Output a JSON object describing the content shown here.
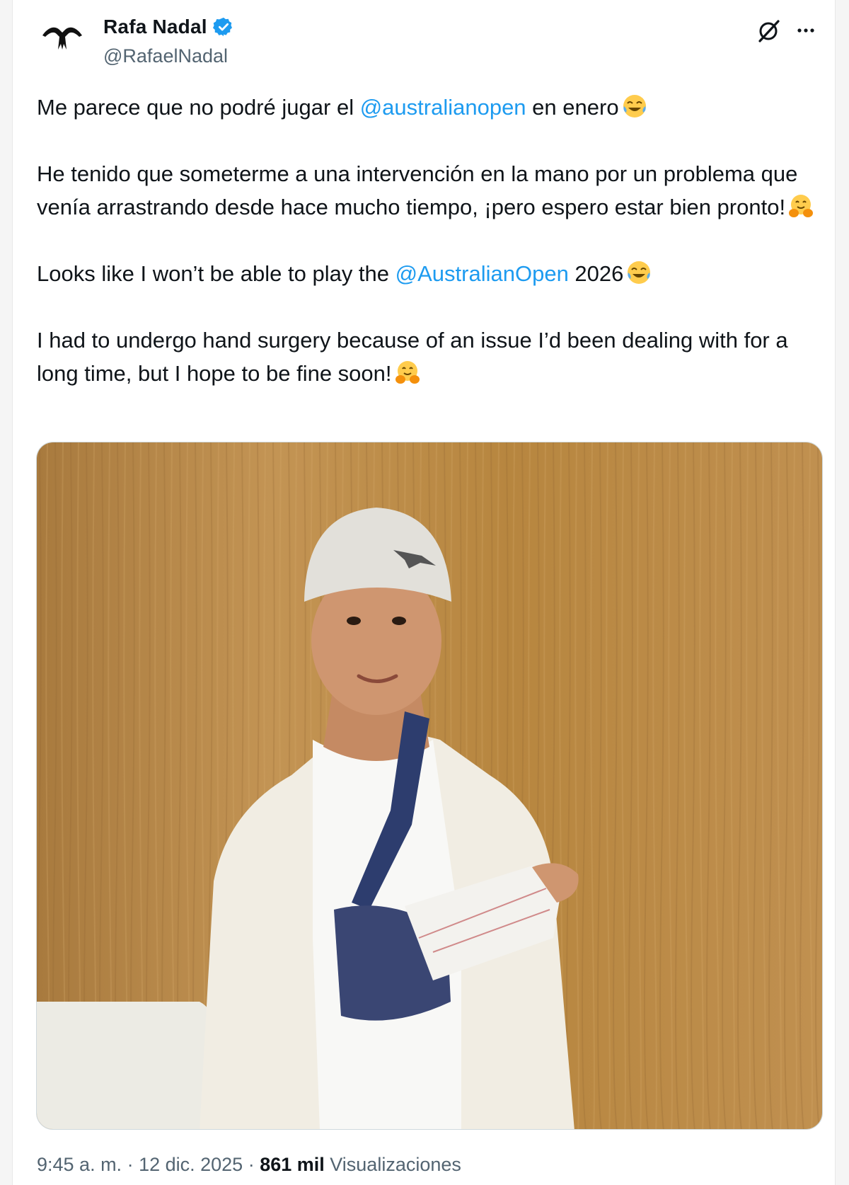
{
  "author": {
    "name": "Rafa Nadal",
    "handle": "@RafaelNadal"
  },
  "tweet": {
    "line1_pre": "Me parece que no podré jugar el ",
    "line1_mention": "@australianopen",
    "line1_post": " en enero",
    "para2": "He tenido que someterme a una intervención en la mano por un problema que venía arrastrando desde hace mucho tiempo, ¡pero espero estar bien pronto!",
    "line3_pre": "Looks like I won’t be able to play the ",
    "line3_mention": "@AustralianOpen",
    "line3_post": " 2026",
    "para4": "I had to undergo hand surgery because of an issue I’d been dealing with for a long time, but I hope to be fine soon!"
  },
  "meta": {
    "time": "9:45 a. m.",
    "sep1": " · ",
    "date": "12 dic. 2025",
    "sep2": " · ",
    "views_count": "861 mil",
    "views_label": " Visualizaciones"
  },
  "colors": {
    "link": "#1d9bf0",
    "verified": "#1d9bf0",
    "secondary_text": "#536471"
  },
  "icons": [
    "verified-badge-icon",
    "grok-icon",
    "more-icon",
    "laughing-emoji-icon",
    "hugging-emoji-icon"
  ]
}
